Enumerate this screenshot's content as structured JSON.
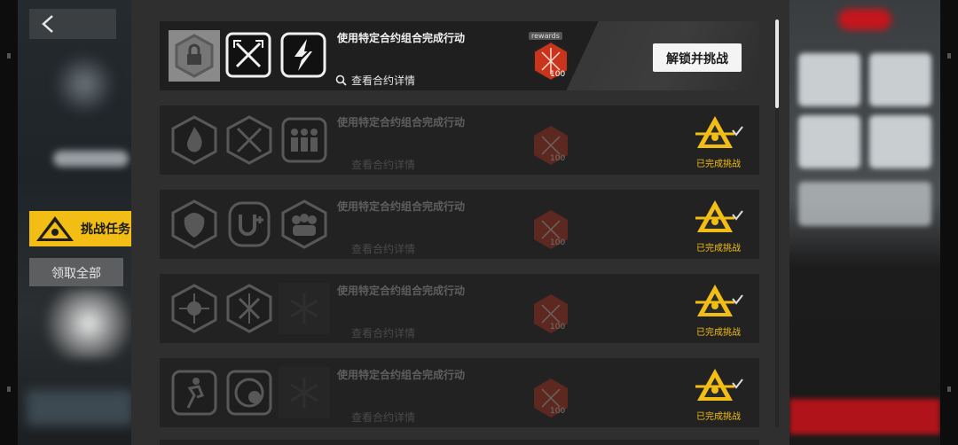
{
  "nav": {
    "back_icon": "chevron-left-icon",
    "challenge_tab_label": "挑战任务",
    "collect_all_label": "领取全部"
  },
  "colors": {
    "accent": "#f2be16",
    "reward_red": "#c9351c",
    "panel": "#2f2f2f",
    "row": "#222222"
  },
  "rows": [
    {
      "title": "使用特定合约组合完成行动",
      "detail": "查看合约详情",
      "icons": [
        "lock-badge-icon",
        "crossed-swords-icon",
        "lightning-slash-icon"
      ],
      "reward_tag": "rewards",
      "reward_qty": "100",
      "state": "locked",
      "action_label": "解锁并挑战"
    },
    {
      "title": "使用特定合约组合完成行动",
      "detail": "查看合约详情",
      "icons": [
        "flame-hex-icon",
        "crossed-blades-icon",
        "squad-icon"
      ],
      "reward_qty": "100",
      "state": "done",
      "done_label": "已完成挑战"
    },
    {
      "title": "使用特定合约组合完成行动",
      "detail": "查看合约详情",
      "icons": [
        "beast-hex-icon",
        "u-plus-icon",
        "crowd-hex-icon"
      ],
      "reward_qty": "100",
      "state": "done",
      "done_label": "已完成挑战"
    },
    {
      "title": "使用特定合约组合完成行动",
      "detail": "查看合约详情",
      "icons": [
        "burst-hex-icon",
        "cross-star-hex-icon",
        "snowflake-icon"
      ],
      "reward_qty": "100",
      "state": "done",
      "done_label": "已完成挑战"
    },
    {
      "title": "使用特定合约组合完成行动",
      "detail": "查看合约详情",
      "icons": [
        "runner-icon",
        "c-target-icon",
        "snowflake-icon"
      ],
      "reward_qty": "100",
      "state": "done",
      "done_label": "已完成挑战"
    }
  ]
}
